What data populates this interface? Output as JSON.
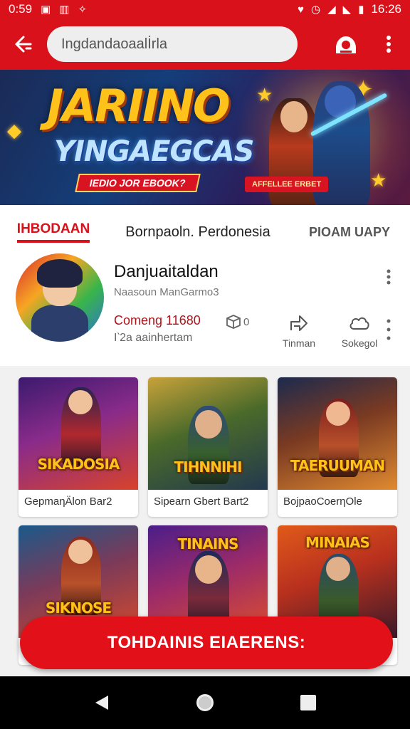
{
  "status_bar": {
    "time_left": "0:59",
    "time_right": "16:26"
  },
  "toolbar": {
    "search_text": "Ingdandaoaalİrla"
  },
  "banner": {
    "title": "JARIINO",
    "subtitle": "YINGAEGCAS",
    "ribbon": "IEDIO JOR EBOOK?",
    "pill": "AFFELLEE ERBET"
  },
  "tabs": [
    {
      "label": "IHBODAAN",
      "active": true
    },
    {
      "label": "Bornpaoln. Perdonesia",
      "active": false
    },
    {
      "label": "PIOAM UAPY",
      "active": false
    }
  ],
  "profile": {
    "name": "Danjuaitaldan",
    "handle": "Naasoun ManGarmo3",
    "count": "Comeng 11680",
    "sub": "I‵2a aainhertam",
    "box_count": "0",
    "actions": [
      {
        "label": "Tinman",
        "icon": "share-icon"
      },
      {
        "label": "Sokegol",
        "icon": "cloud-icon"
      }
    ]
  },
  "cards": [
    {
      "title": "SIKADOSIA",
      "label": "GepmaηÄlon Bar2"
    },
    {
      "title": "TIHNNIHI",
      "label": "Sipearn Gbert Bart2"
    },
    {
      "title": "TAERUUMAN",
      "label": "BojpaoCoerηOle"
    },
    {
      "title": "SIKNOSE",
      "label": ""
    },
    {
      "title": "TINAINS",
      "label": ""
    },
    {
      "title": "MINAIAS",
      "label": ""
    }
  ],
  "cta": {
    "label": "TOHDAINIS EIAERENS:"
  },
  "colors": {
    "primary": "#d8111a",
    "cta": "#e21018"
  }
}
